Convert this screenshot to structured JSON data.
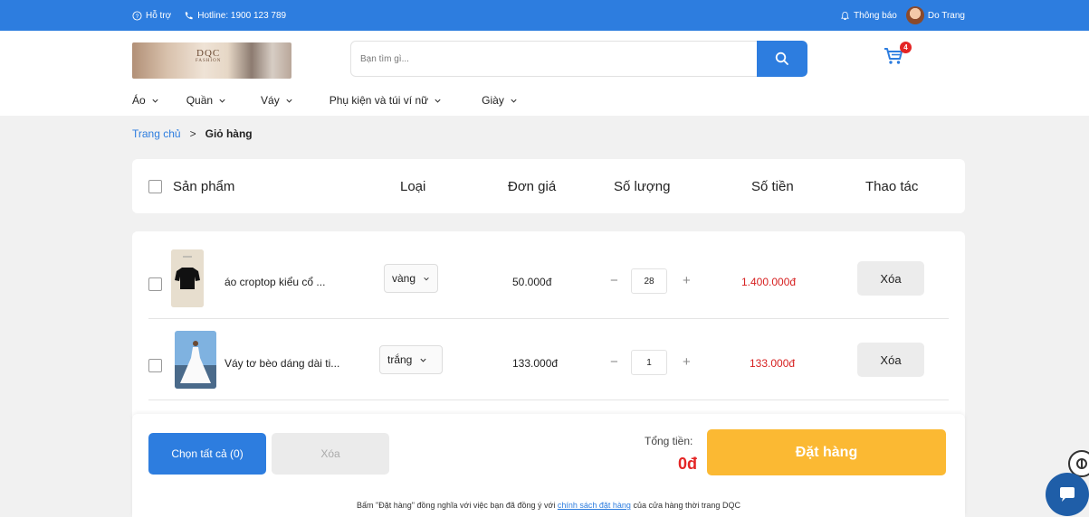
{
  "topbar": {
    "help_label": "Hỗ trợ",
    "hotline_label": "Hotline: 1900 123 789",
    "notify_label": "Thông báo",
    "user_name": "Do Trang"
  },
  "header": {
    "logo_text": "DQC",
    "logo_sub": "FASHION",
    "search_placeholder": "Bạn tìm gì...",
    "cart_count": "4"
  },
  "nav": {
    "items": [
      "Áo",
      "Quần",
      "Váy",
      "Phụ kiện và túi ví nữ",
      "Giày"
    ]
  },
  "breadcrumb": {
    "home": "Trang chủ",
    "separator": ">",
    "current": "Giỏ hàng"
  },
  "table": {
    "headers": {
      "product": "Sản phẩm",
      "type": "Loại",
      "unit_price": "Đơn giá",
      "quantity": "Số lượng",
      "amount": "Số tiền",
      "actions": "Thao tác"
    },
    "rows": [
      {
        "name": "áo croptop kiểu cổ ...",
        "variant": "vàng",
        "price": "50.000đ",
        "qty": "28",
        "subtotal": "1.400.000đ",
        "delete_label": "Xóa"
      },
      {
        "name": "Váy tơ bèo dáng dài ti...",
        "variant": "trắng",
        "price": "133.000đ",
        "qty": "1",
        "subtotal": "133.000đ",
        "delete_label": "Xóa"
      }
    ],
    "minus": "−",
    "plus": "+"
  },
  "footer": {
    "select_all_label": "Chọn tất cả (0)",
    "delete_label": "Xóa",
    "total_label": "Tổng tiền:",
    "total_value": "0đ",
    "order_label": "Đặt hàng",
    "policy_prefix": "Bấm \"Đặt hàng\" đồng nghĩa với việc bạn đã đồng ý với",
    "policy_link": "chính sách đặt hàng",
    "policy_suffix": "của cửa hàng thời trang DQC"
  },
  "colors": {
    "primary": "#2d7ddf",
    "accent": "#fbb933",
    "price_red": "#d61f1f",
    "badge": "#e42525"
  }
}
